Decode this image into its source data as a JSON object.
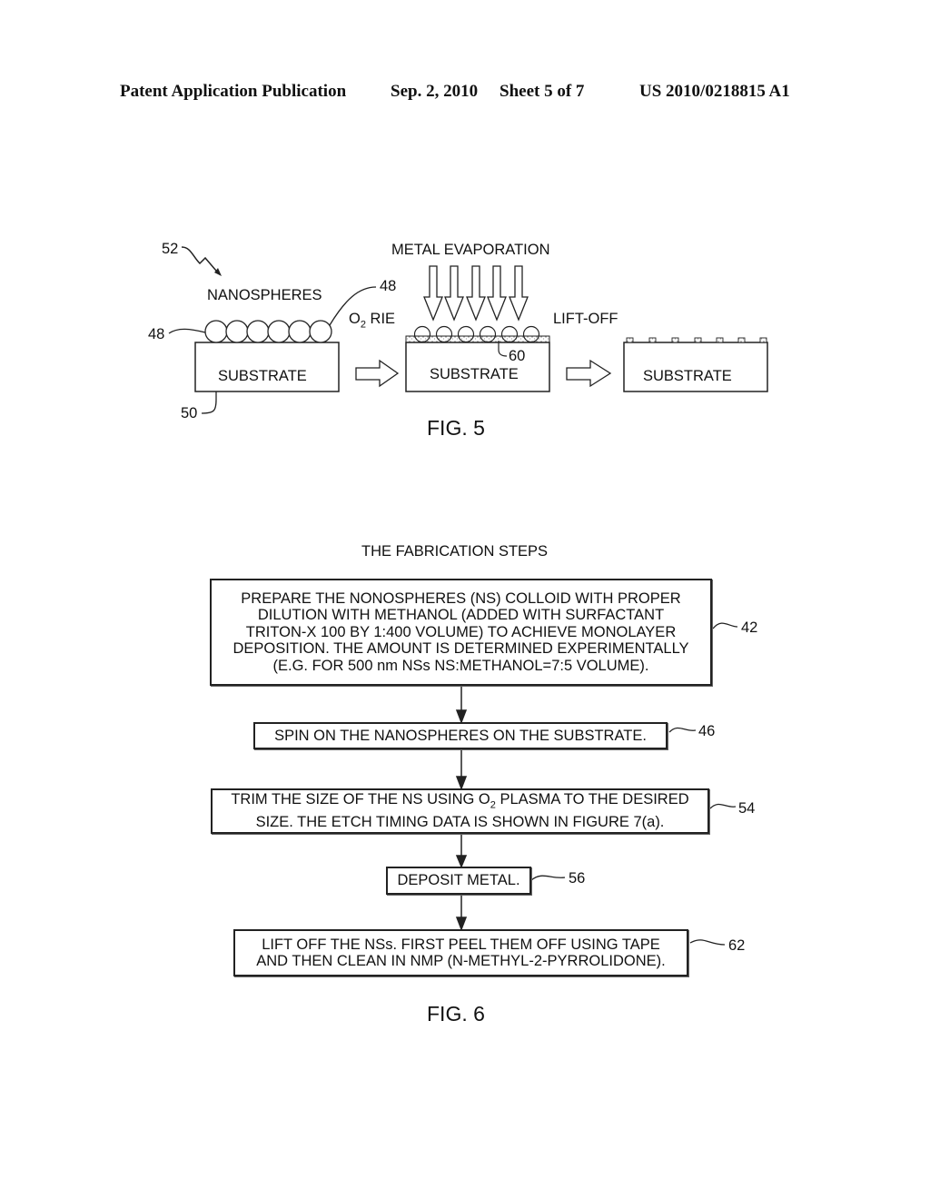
{
  "header": {
    "publication": "Patent Application Publication",
    "date": "Sep. 2, 2010",
    "sheet": "Sheet 5 of 7",
    "number": "US 2010/0218815 A1"
  },
  "fig5": {
    "caption": "FIG. 5",
    "ref_52": "52",
    "ref_48_left": "48",
    "ref_48_right": "48",
    "ref_50": "50",
    "ref_60": "60",
    "nanospheres_label": "NANOSPHERES",
    "o2_rie_O": "O",
    "o2_rie_sub": "2",
    "o2_rie_rest": " RIE",
    "metal_evaporation_label": "METAL EVAPORATION",
    "lift_off_label": "LIFT-OFF",
    "substrate_1": "SUBSTRATE",
    "substrate_2": "SUBSTRATE",
    "substrate_3": "SUBSTRATE"
  },
  "fig6": {
    "title": "THE FABRICATION STEPS",
    "caption": "FIG. 6",
    "steps": [
      {
        "ref": "42",
        "text": "PREPARE THE NONOSPHERES (NS) COLLOID WITH PROPER\nDILUTION WITH METHANOL (ADDED WITH SURFACTANT\nTRITON-X 100 BY 1:400 VOLUME) TO ACHIEVE MONOLAYER\nDEPOSITION.  THE AMOUNT IS DETERMINED EXPERIMENTALLY\n(E.G. FOR 500 nm NSs NS:METHANOL=7:5 VOLUME)."
      },
      {
        "ref": "46",
        "text": "SPIN ON THE NANOSPHERES ON THE SUBSTRATE."
      },
      {
        "ref": "54",
        "text_a": "TRIM THE SIZE OF THE NS USING O",
        "text_sub": "2",
        "text_b": " PLASMA TO THE DESIRED",
        "text_c": "SIZE.  THE ETCH TIMING DATA IS SHOWN IN FIGURE 7(a)."
      },
      {
        "ref": "56",
        "text": "DEPOSIT METAL."
      },
      {
        "ref": "62",
        "text": "LIFT OFF THE NSs.  FIRST PEEL THEM OFF USING TAPE\nAND THEN CLEAN IN NMP (N-METHYL-2-PYRROLIDONE)."
      }
    ]
  }
}
